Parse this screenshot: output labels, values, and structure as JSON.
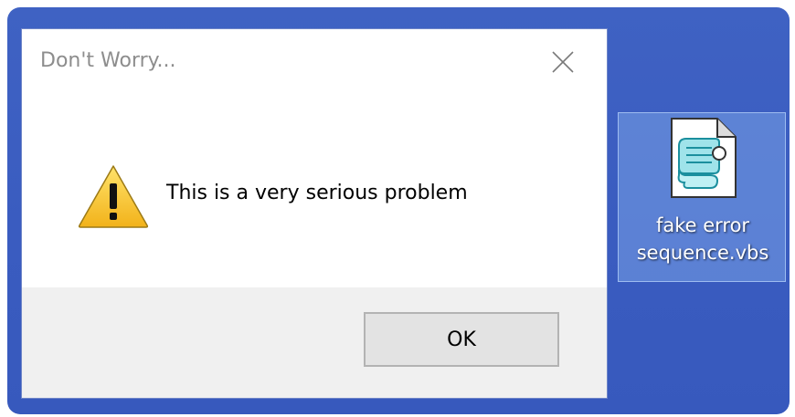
{
  "dialog": {
    "title": "Don't Worry...",
    "message": "This is a very serious problem",
    "ok_label": "OK",
    "close_icon": "close-icon",
    "warning_icon": "warning-icon"
  },
  "desktop_icon": {
    "label_line1": "fake error",
    "label_line2": "sequence.vbs",
    "icon": "vbs-script-file-icon"
  },
  "colors": {
    "desktop_bg": "#3f62c3",
    "dialog_bg": "#ffffff",
    "footer_bg": "#f0f0f0",
    "button_bg": "#e3e3e3",
    "title_text": "#8d8d8d",
    "warning_yellow": "#f7c52b"
  }
}
